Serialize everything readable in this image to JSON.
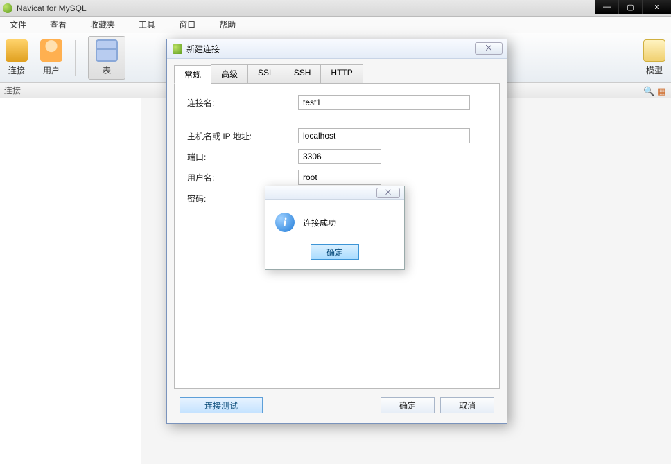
{
  "app": {
    "title": "Navicat for MySQL"
  },
  "win_controls": {
    "min": "—",
    "max": "▢",
    "close": "x"
  },
  "menu": {
    "file": "文件",
    "view": "查看",
    "favorites": "收藏夹",
    "tools": "工具",
    "window": "窗口",
    "help": "帮助"
  },
  "toolbar": {
    "connect": "连接",
    "user": "用户",
    "table": "表",
    "model": "模型"
  },
  "subheader": {
    "label": "连接"
  },
  "dialog": {
    "title": "新建连接",
    "close_glyph": "⨉",
    "tabs": {
      "general": "常规",
      "advanced": "高级",
      "ssl": "SSL",
      "ssh": "SSH",
      "http": "HTTP"
    },
    "fields": {
      "conn_name_label": "连接名:",
      "conn_name_value": "test1",
      "host_label": "主机名或 IP 地址:",
      "host_value": "localhost",
      "port_label": "端口:",
      "port_value": "3306",
      "user_label": "用户名:",
      "user_value": "root",
      "pwd_label": "密码:",
      "pwd_value": ""
    },
    "buttons": {
      "test": "连接测试",
      "ok": "确定",
      "cancel": "取消"
    }
  },
  "msgbox": {
    "text": "连接成功",
    "ok": "确定",
    "close_glyph": "⨉"
  }
}
